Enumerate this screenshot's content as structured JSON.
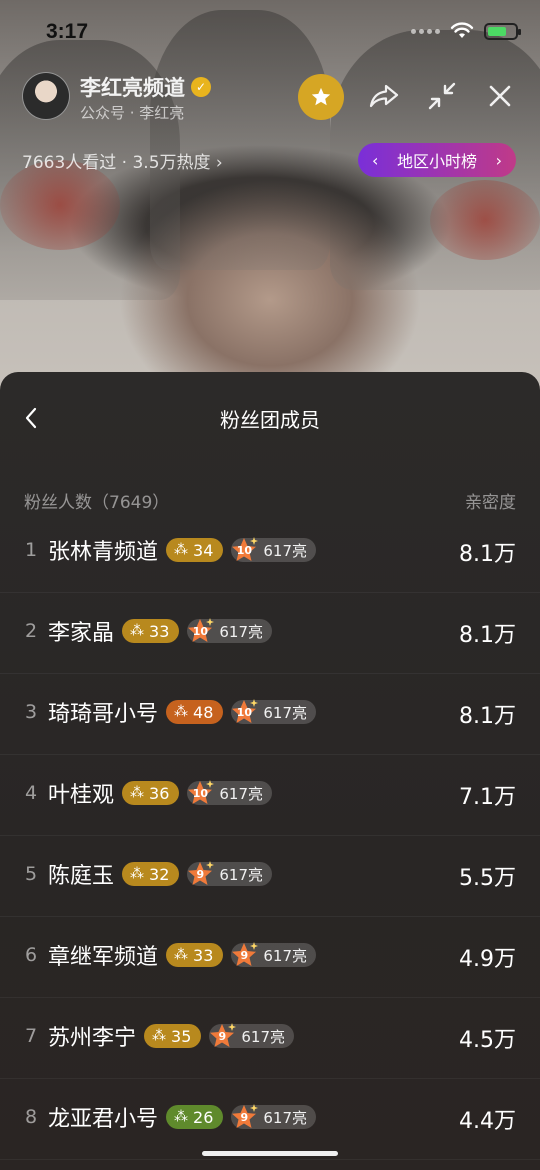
{
  "status_bar": {
    "time": "3:17"
  },
  "header": {
    "channel_name": "李红亮频道",
    "channel_sub": "公众号 · 李红亮",
    "viewers": "7663人看过 · 3.5万热度",
    "rank_pill": "地区小时榜"
  },
  "panel": {
    "title": "粉丝团成员",
    "count_label": "粉丝人数（7649）",
    "intimacy_label": "亲密度",
    "members": [
      {
        "rank": "1",
        "name": "张林青频道",
        "level": "34",
        "level_color": "#b8891e",
        "fan_level": "10",
        "fan_text": "617亮",
        "score": "8.1万"
      },
      {
        "rank": "2",
        "name": "李家晶",
        "level": "33",
        "level_color": "#b8891e",
        "fan_level": "10",
        "fan_text": "617亮",
        "score": "8.1万"
      },
      {
        "rank": "3",
        "name": "琦琦哥小号",
        "level": "48",
        "level_color": "#c6621e",
        "fan_level": "10",
        "fan_text": "617亮",
        "score": "8.1万"
      },
      {
        "rank": "4",
        "name": "叶桂观",
        "level": "36",
        "level_color": "#b8891e",
        "fan_level": "10",
        "fan_text": "617亮",
        "score": "7.1万"
      },
      {
        "rank": "5",
        "name": "陈庭玉",
        "level": "32",
        "level_color": "#b8891e",
        "fan_level": "9",
        "fan_text": "617亮",
        "score": "5.5万"
      },
      {
        "rank": "6",
        "name": "章继军频道",
        "level": "33",
        "level_color": "#b8891e",
        "fan_level": "9",
        "fan_text": "617亮",
        "score": "4.9万"
      },
      {
        "rank": "7",
        "name": "苏州李宁",
        "level": "35",
        "level_color": "#b8891e",
        "fan_level": "9",
        "fan_text": "617亮",
        "score": "4.5万"
      },
      {
        "rank": "8",
        "name": "龙亚君小号",
        "level": "26",
        "level_color": "#5f8a2c",
        "fan_level": "9",
        "fan_text": "617亮",
        "score": "4.4万"
      }
    ]
  },
  "icons": {
    "back": "chevron-left-icon",
    "share": "share-icon",
    "shrink": "shrink-icon",
    "close": "close-icon",
    "star": "star-icon"
  }
}
